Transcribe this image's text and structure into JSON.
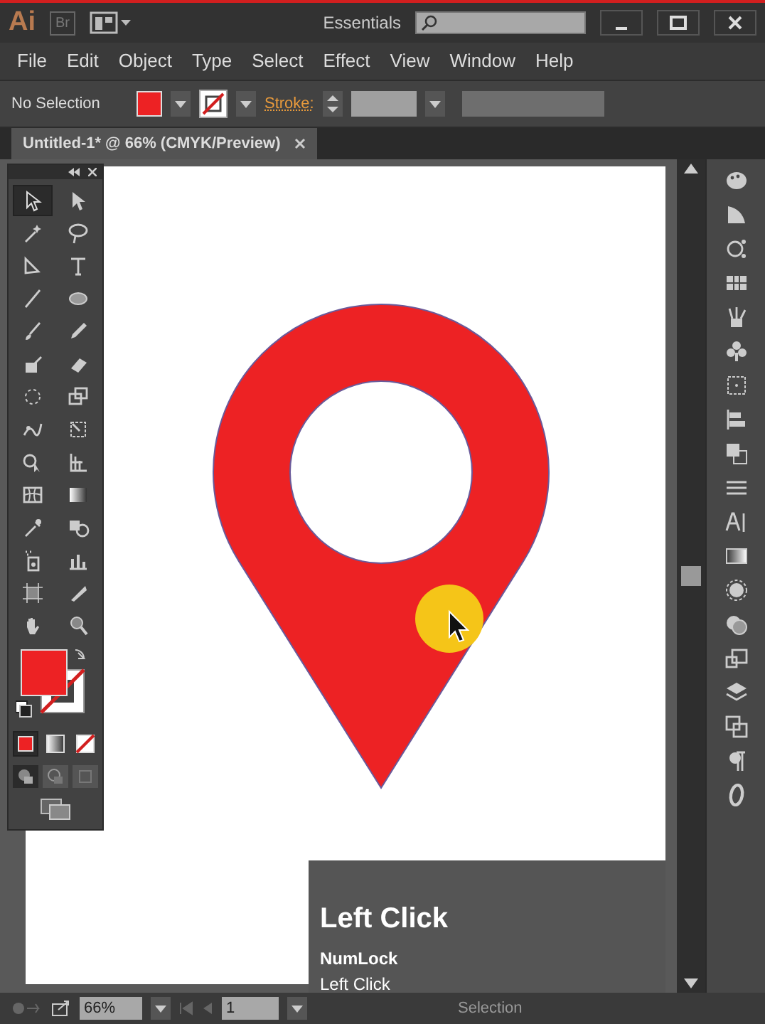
{
  "title_bar": {
    "logo": "Ai",
    "bridge": "Br",
    "workspace": "Essentials"
  },
  "menu": [
    "File",
    "Edit",
    "Object",
    "Type",
    "Select",
    "Effect",
    "View",
    "Window",
    "Help"
  ],
  "control_bar": {
    "selection": "No Selection",
    "stroke_label": "Stroke:"
  },
  "document_tab": {
    "title": "Untitled-1* @ 66% (CMYK/Preview)"
  },
  "tools": [
    {
      "selected": true
    },
    {
      "selected": false
    },
    {
      "selected": false
    },
    {
      "selected": false
    },
    {
      "selected": false
    },
    {
      "selected": false
    },
    {
      "selected": false
    },
    {
      "selected": false
    },
    {
      "selected": false
    },
    {
      "selected": false
    },
    {
      "selected": false
    },
    {
      "selected": false
    },
    {
      "selected": false
    },
    {
      "selected": false
    },
    {
      "selected": false
    },
    {
      "selected": false
    },
    {
      "selected": false
    },
    {
      "selected": false
    },
    {
      "selected": false
    },
    {
      "selected": false
    },
    {
      "selected": false
    },
    {
      "selected": false
    },
    {
      "selected": false
    },
    {
      "selected": false
    },
    {
      "selected": false
    },
    {
      "selected": false
    },
    {
      "selected": false
    },
    {
      "selected": false
    }
  ],
  "keystroke_overlay": {
    "title": "Left Click",
    "key": "NumLock",
    "action": "Left Click"
  },
  "status_bar": {
    "zoom": "66%",
    "page": "1",
    "status": "Selection"
  }
}
